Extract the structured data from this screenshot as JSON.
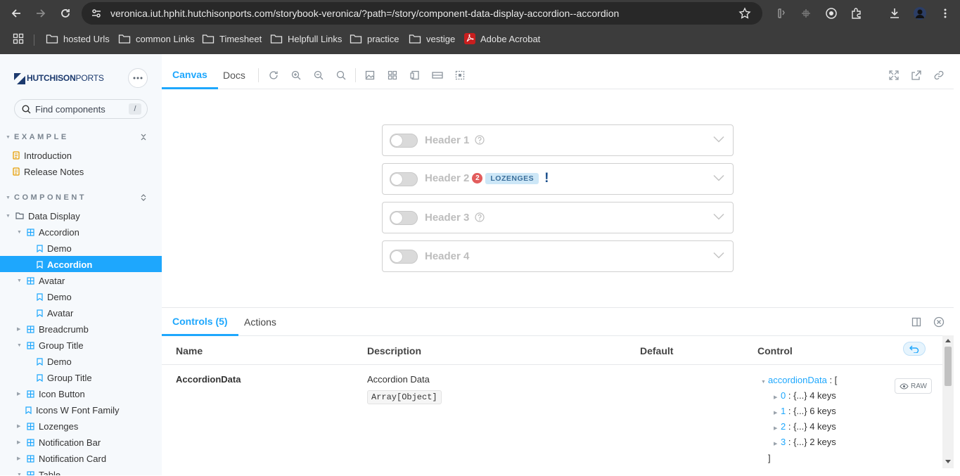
{
  "browser": {
    "url": "veronica.iut.hphit.hutchisonports.com/storybook-veronica/?path=/story/component-data-display-accordion--accordion",
    "bookmarks": [
      {
        "label": "hosted Urls",
        "icon": "folder-icon"
      },
      {
        "label": "common Links",
        "icon": "folder-icon"
      },
      {
        "label": "Timesheet",
        "icon": "folder-icon"
      },
      {
        "label": "Helpfull Links",
        "icon": "folder-icon"
      },
      {
        "label": "practice",
        "icon": "folder-icon"
      },
      {
        "label": "vestige",
        "icon": "folder-icon"
      },
      {
        "label": "Adobe Acrobat",
        "icon": "acrobat-icon"
      }
    ]
  },
  "sidebar": {
    "logo": {
      "bold": "HUTCHISON",
      "light": "PORTS"
    },
    "search_placeholder": "Find components",
    "search_shortcut": "/",
    "sections": [
      {
        "label": "EXAMPLE",
        "items": [
          "Introduction",
          "Release Notes"
        ]
      },
      {
        "label": "COMPONENT"
      }
    ],
    "tree": [
      {
        "label": "Data Display",
        "depth": 0,
        "type": "folder",
        "expanded": true
      },
      {
        "label": "Accordion",
        "depth": 1,
        "type": "component",
        "expanded": true
      },
      {
        "label": "Demo",
        "depth": 2,
        "type": "story"
      },
      {
        "label": "Accordion",
        "depth": 2,
        "type": "story",
        "selected": true
      },
      {
        "label": "Avatar",
        "depth": 1,
        "type": "component",
        "expanded": true
      },
      {
        "label": "Demo",
        "depth": 2,
        "type": "story"
      },
      {
        "label": "Avatar",
        "depth": 2,
        "type": "story"
      },
      {
        "label": "Breadcrumb",
        "depth": 1,
        "type": "component",
        "expanded": false
      },
      {
        "label": "Group Title",
        "depth": 1,
        "type": "component",
        "expanded": true
      },
      {
        "label": "Demo",
        "depth": 2,
        "type": "story"
      },
      {
        "label": "Group Title",
        "depth": 2,
        "type": "story"
      },
      {
        "label": "Icon Button",
        "depth": 1,
        "type": "component",
        "expanded": false
      },
      {
        "label": "Icons W Font Family",
        "depth": 1,
        "type": "story"
      },
      {
        "label": "Lozenges",
        "depth": 1,
        "type": "component",
        "expanded": false
      },
      {
        "label": "Notification Bar",
        "depth": 1,
        "type": "component",
        "expanded": false
      },
      {
        "label": "Notification Card",
        "depth": 1,
        "type": "component",
        "expanded": false
      },
      {
        "label": "Table",
        "depth": 1,
        "type": "component",
        "expanded": true
      }
    ]
  },
  "toolbar": {
    "tabs": [
      "Canvas",
      "Docs"
    ],
    "active_tab": "Canvas"
  },
  "canvas": {
    "accordions": [
      {
        "title": "Header 1",
        "help": true
      },
      {
        "title": "Header 2",
        "badge_count": "2",
        "lozenge": "LOZENGES",
        "alert": "!"
      },
      {
        "title": "Header 3",
        "help": true
      },
      {
        "title": "Header 4"
      }
    ]
  },
  "addons": {
    "tabs": [
      "Controls (5)",
      "Actions"
    ],
    "active_tab": "Controls (5)",
    "columns": [
      "Name",
      "Description",
      "Default",
      "Control"
    ],
    "row": {
      "name": "AccordionData",
      "description": "Accordion Data",
      "type": "Array[Object]",
      "control": {
        "key": "accordionData",
        "open": " : [",
        "items": [
          {
            "index": "0",
            "summary": "{...} 4 keys"
          },
          {
            "index": "1",
            "summary": "{...} 6 keys"
          },
          {
            "index": "2",
            "summary": "{...} 4 keys"
          },
          {
            "index": "3",
            "summary": "{...} 2 keys"
          }
        ],
        "close": "]",
        "raw_label": "RAW"
      }
    }
  },
  "colors": {
    "accent": "#1ea7fd",
    "lozenge_bg": "#cde7f7",
    "badge": "#e25c5c",
    "alert": "#1b4f8c"
  }
}
